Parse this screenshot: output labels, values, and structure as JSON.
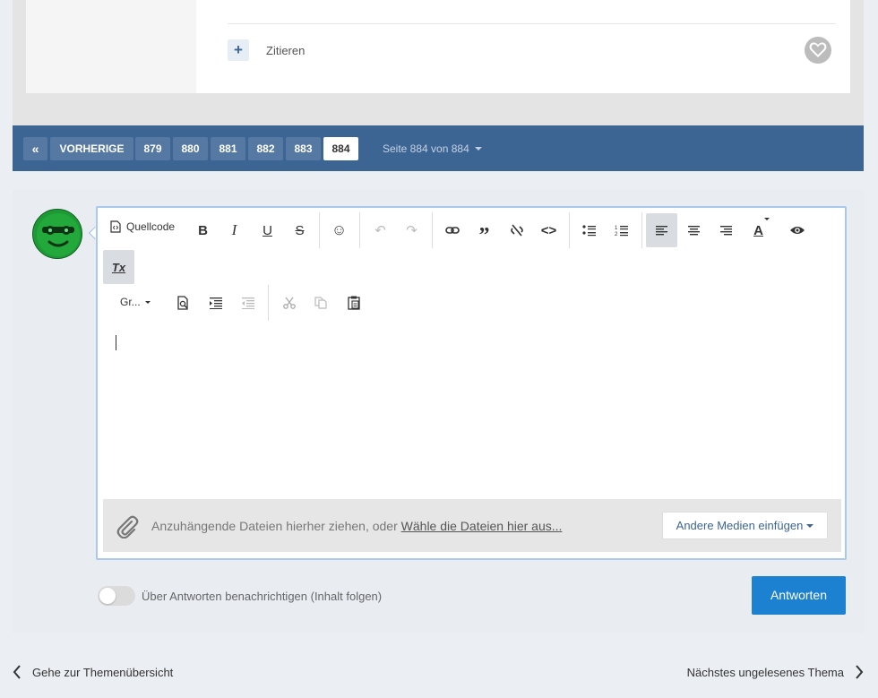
{
  "post": {
    "quote_plus": "+",
    "quote_label": "Zitieren"
  },
  "pagination": {
    "first_symbol": "«",
    "prev_label": "VORHERIGE",
    "pages": [
      "879",
      "880",
      "881",
      "882",
      "883",
      "884"
    ],
    "active_page": "884",
    "page_info": "Seite 884 von 884"
  },
  "editor": {
    "source_label": "Quellcode",
    "format_label": "Gr...",
    "toolbar_glyphs": {
      "bold": "B",
      "italic": "I",
      "underline": "U",
      "strike": "S",
      "emoji": "☺",
      "undo": "↶",
      "redo": "↷",
      "link": "🔗",
      "quote": "”",
      "unlink": "⤫",
      "code": "<>",
      "text_color": "A",
      "preview": "👁",
      "remove_format": "Tx"
    },
    "attach_text": "Anzuhängende Dateien hierher ziehen, oder ",
    "attach_link": "Wähle die Dateien hier aus...",
    "media_button": "Andere Medien einfügen"
  },
  "reply": {
    "follow_label": "Über Antworten benachrichtigen (Inhalt folgen)",
    "submit_label": "Antworten"
  },
  "nav": {
    "back_label": "Gehe zur Themenübersicht",
    "next_label": "Nächstes ungelesenes Thema"
  },
  "colors": {
    "pager_bg": "#3d6594",
    "pager_button": "#5679a3",
    "submit_bg": "#1d81d1",
    "editor_border": "#a9c8ec"
  }
}
